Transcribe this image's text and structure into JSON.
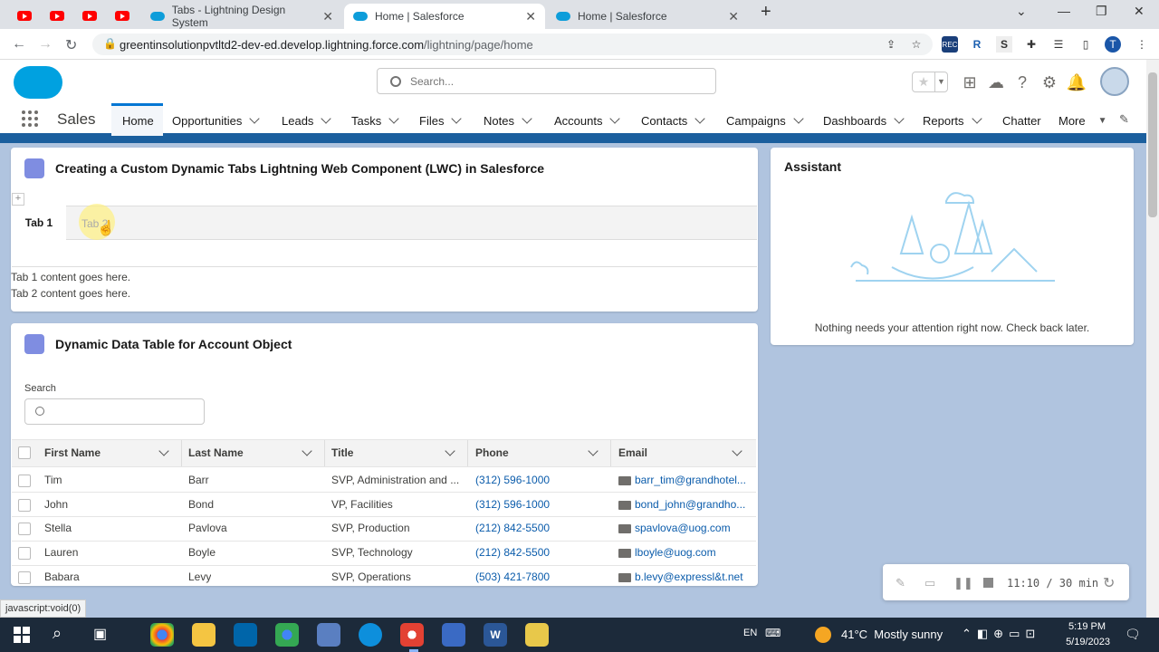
{
  "browser": {
    "tabs": [
      {
        "label": "Tabs - Lightning Design System"
      },
      {
        "label": "Home | Salesforce"
      },
      {
        "label": "Home | Salesforce"
      }
    ],
    "url_host": "greentinsolutionpvtltd2-dev-ed.develop.lightning.force.com",
    "url_path": "/lightning/page/home",
    "status_url": "javascript:void(0)"
  },
  "header": {
    "search_placeholder": "Search...",
    "app_name": "Sales"
  },
  "nav": {
    "items": [
      "Home",
      "Opportunities",
      "Leads",
      "Tasks",
      "Files",
      "Notes",
      "Accounts",
      "Contacts",
      "Campaigns",
      "Dashboards",
      "Reports",
      "Chatter",
      "More"
    ]
  },
  "tabs_card": {
    "title": "Creating a Custom Dynamic Tabs Lightning Web Component (LWC) in Salesforce",
    "tab1": "Tab 1",
    "tab2": "Tab 2",
    "content1": "Tab 1 content goes here.",
    "content2": "Tab 2 content goes here."
  },
  "table_card": {
    "title": "Dynamic Data Table for Account Object",
    "search_label": "Search",
    "columns": [
      "First Name",
      "Last Name",
      "Title",
      "Phone",
      "Email"
    ],
    "rows": [
      {
        "first": "Tim",
        "last": "Barr",
        "title": "SVP, Administration and ...",
        "phone": "(312) 596-1000",
        "email": "barr_tim@grandhotel..."
      },
      {
        "first": "John",
        "last": "Bond",
        "title": "VP, Facilities",
        "phone": "(312) 596-1000",
        "email": "bond_john@grandho..."
      },
      {
        "first": "Stella",
        "last": "Pavlova",
        "title": "SVP, Production",
        "phone": "(212) 842-5500",
        "email": "spavlova@uog.com"
      },
      {
        "first": "Lauren",
        "last": "Boyle",
        "title": "SVP, Technology",
        "phone": "(212) 842-5500",
        "email": "lboyle@uog.com"
      },
      {
        "first": "Babara",
        "last": "Levy",
        "title": "SVP, Operations",
        "phone": "(503) 421-7800",
        "email": "b.levy@expressl&t.net"
      }
    ]
  },
  "assistant": {
    "title": "Assistant",
    "message": "Nothing needs your attention right now. Check back later."
  },
  "recorder": {
    "time": "11:10 / 30 min"
  },
  "taskbar": {
    "lang": "EN",
    "weather": "41°C  Mostly sunny",
    "time": "5:19 PM",
    "date": "5/19/2023"
  }
}
